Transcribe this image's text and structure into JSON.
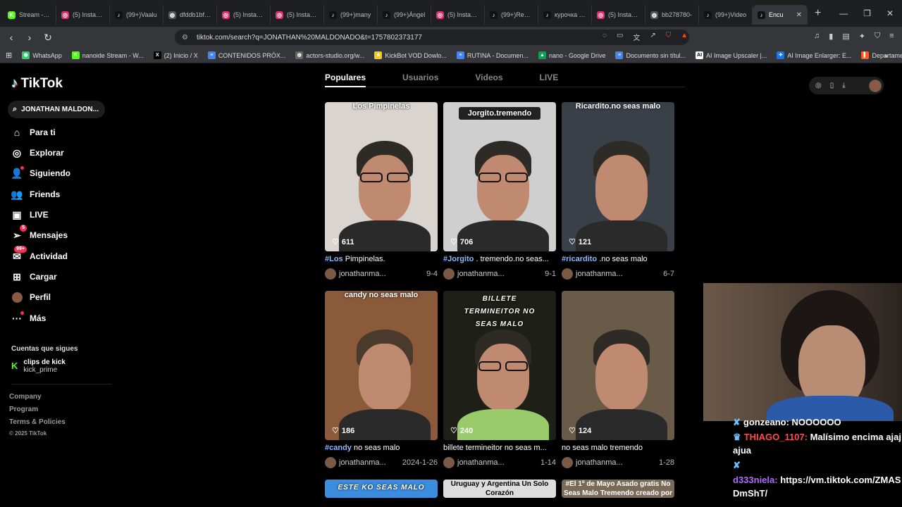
{
  "browser": {
    "tabs": [
      {
        "label": "Stream - Kic",
        "color": "#53fc18",
        "glyph": "K"
      },
      {
        "label": "(5) Instagra",
        "color": "#e1306c",
        "glyph": "◎"
      },
      {
        "label": "(99+)Vaalu",
        "color": "#111111",
        "glyph": "♪"
      },
      {
        "label": "dfddb1bf72",
        "color": "#555555",
        "glyph": "◍"
      },
      {
        "label": "(5) Instagra",
        "color": "#e1306c",
        "glyph": "◎"
      },
      {
        "label": "(5) Instagra",
        "color": "#e1306c",
        "glyph": "◎"
      },
      {
        "label": "(99+)many",
        "color": "#111111",
        "glyph": "♪"
      },
      {
        "label": "(99+)Ángel",
        "color": "#111111",
        "glyph": "♪"
      },
      {
        "label": "(5) Instagra",
        "color": "#e1306c",
        "glyph": "◎"
      },
      {
        "label": "(99+)Recue",
        "color": "#111111",
        "glyph": "♪"
      },
      {
        "label": "курочка дар",
        "color": "#111111",
        "glyph": "♪"
      },
      {
        "label": "(5) Instagra",
        "color": "#e1306c",
        "glyph": "◎"
      },
      {
        "label": "bb278780-",
        "color": "#555555",
        "glyph": "◍"
      },
      {
        "label": "(99+)Video",
        "color": "#111111",
        "glyph": "♪"
      },
      {
        "label": "Encu",
        "color": "#111111",
        "glyph": "♪",
        "active": true
      }
    ],
    "new_tab": "+",
    "window_controls": [
      "—",
      "❐",
      "✕"
    ],
    "url": "tiktok.com/search?q=JONATHAN%20MALDONADO&t=1757802373177",
    "url_lead_icon": "⚙",
    "bookmarks": [
      {
        "label": "WhatsApp",
        "color": "#25d366",
        "glyph": "◉"
      },
      {
        "label": "nanoide Stream - W...",
        "color": "#53fc18",
        "glyph": "K"
      },
      {
        "label": "(2) Inicio / X",
        "color": "#000000",
        "glyph": "X"
      },
      {
        "label": "CONTENIDOS PRÓX...",
        "color": "#4285f4",
        "glyph": "≡"
      },
      {
        "label": "actors-studio.org/w...",
        "color": "#666666",
        "glyph": "◍"
      },
      {
        "label": "KickBot VOD Dowlo...",
        "color": "#f6c915",
        "glyph": "★"
      },
      {
        "label": "RUTINA - Documen...",
        "color": "#4285f4",
        "glyph": "≡"
      },
      {
        "label": "nano - Google Drive",
        "color": "#0f9d58",
        "glyph": "▲"
      },
      {
        "label": "Documento sin títul...",
        "color": "#4285f4",
        "glyph": "≡"
      },
      {
        "label": "AI Image Upscaler |...",
        "color": "#ffffff",
        "glyph": "AI"
      },
      {
        "label": "AI Image Enlarger: E...",
        "color": "#1a73e8",
        "glyph": "✈"
      },
      {
        "label": "Departamento en Al...",
        "color": "#ff5a1f",
        "glyph": "▌"
      }
    ],
    "bookmarks_more": "»"
  },
  "sidebar": {
    "logo": "TikTok",
    "search_value": "JONATHAN MALDON...",
    "menu": [
      {
        "label": "Para ti",
        "icon": "home-icon",
        "glyph": "⌂"
      },
      {
        "label": "Explorar",
        "icon": "compass-icon",
        "glyph": "◎"
      },
      {
        "label": "Siguiendo",
        "icon": "following-icon",
        "glyph": "👤"
      },
      {
        "label": "Friends",
        "icon": "friends-icon",
        "glyph": "👥"
      },
      {
        "label": "LIVE",
        "icon": "live-icon",
        "glyph": "▣"
      },
      {
        "label": "Mensajes",
        "icon": "messages-icon",
        "glyph": "➢",
        "badge": "5"
      },
      {
        "label": "Actividad",
        "icon": "activity-icon",
        "glyph": "✉",
        "badge": "99+"
      },
      {
        "label": "Cargar",
        "icon": "upload-icon",
        "glyph": "⊞"
      },
      {
        "label": "Perfil",
        "icon": "profile-avatar-icon",
        "glyph": "●"
      },
      {
        "label": "Más",
        "icon": "more-icon",
        "glyph": "···"
      }
    ],
    "following_title": "Cuentas que sigues",
    "followed": {
      "name": "clips de kick",
      "handle": "kick_prime"
    },
    "footer": [
      "Company",
      "Program",
      "Terms & Policies",
      "© 2025 TikTok"
    ]
  },
  "results": {
    "tabs": [
      "Populares",
      "Usuarios",
      "Videos",
      "LIVE"
    ],
    "active_tab": "Populares",
    "videos": [
      {
        "caption": "Los Pimpinelas",
        "likes": "611",
        "tag": "#Los",
        "desc": " Pimpinelas.",
        "user": "jonathanma...",
        "date": "9-4",
        "bg": "#d9d4cf"
      },
      {
        "caption": "Jorgito.tremendo",
        "likes": "706",
        "tag": "#Jorgito",
        "desc": " . tremendo.no seas...",
        "user": "jonathanma...",
        "date": "9-1",
        "bg": "#cfcfcf"
      },
      {
        "caption": "Ricardito.no seas malo",
        "likes": "121",
        "tag": "#ricardito",
        "desc": " .no seas malo",
        "user": "jonathanma...",
        "date": "6-7",
        "bg": "#3a4048"
      },
      {
        "caption": "candy no seas malo",
        "likes": "186",
        "tag": "#candy",
        "desc": " no seas malo",
        "user": "jonathanma...",
        "date": "2024-1-26",
        "bg": "#8a5a3a"
      },
      {
        "caption": "BILLETE TERMINEITOR NO SEAS MALO",
        "likes": "240",
        "tag": "",
        "desc": "billete termineitor no seas m...",
        "user": "jonathanma...",
        "date": "1-14",
        "bg": "#1e2018"
      },
      {
        "caption": "",
        "likes": "124",
        "tag": "",
        "desc": "no seas malo tremendo",
        "user": "jonathanma...",
        "date": "1-28",
        "bg": "#6a5a48"
      },
      {
        "caption": "ESTE KO SEAS MALO",
        "likes": "",
        "tag": "",
        "desc": "",
        "user": "",
        "date": "",
        "bg": "#3b8de0"
      },
      {
        "caption": "Uruguay y Argentina Un Solo Corazón",
        "likes": "",
        "tag": "",
        "desc": "",
        "user": "",
        "date": "",
        "bg": "#dddddd"
      },
      {
        "caption": "#El 1º de Mayo Asado gratis No Seas Malo Tremendo creado por",
        "likes": "",
        "tag": "",
        "desc": "",
        "user": "",
        "date": "",
        "bg": "#7a6a58"
      }
    ]
  },
  "chat": [
    {
      "icon": "✘",
      "user": "",
      "text": "gonzeano: NOOOOOO"
    },
    {
      "icon": "♛",
      "user": "THIAGO_1107:",
      "text": " Malísimo encima ajajajua"
    },
    {
      "icon": "✘",
      "user": "",
      "text": ""
    },
    {
      "icon": "",
      "user": "d333niela:",
      "text": " https://vm.tiktok.com/ZMASDmShT/"
    }
  ]
}
